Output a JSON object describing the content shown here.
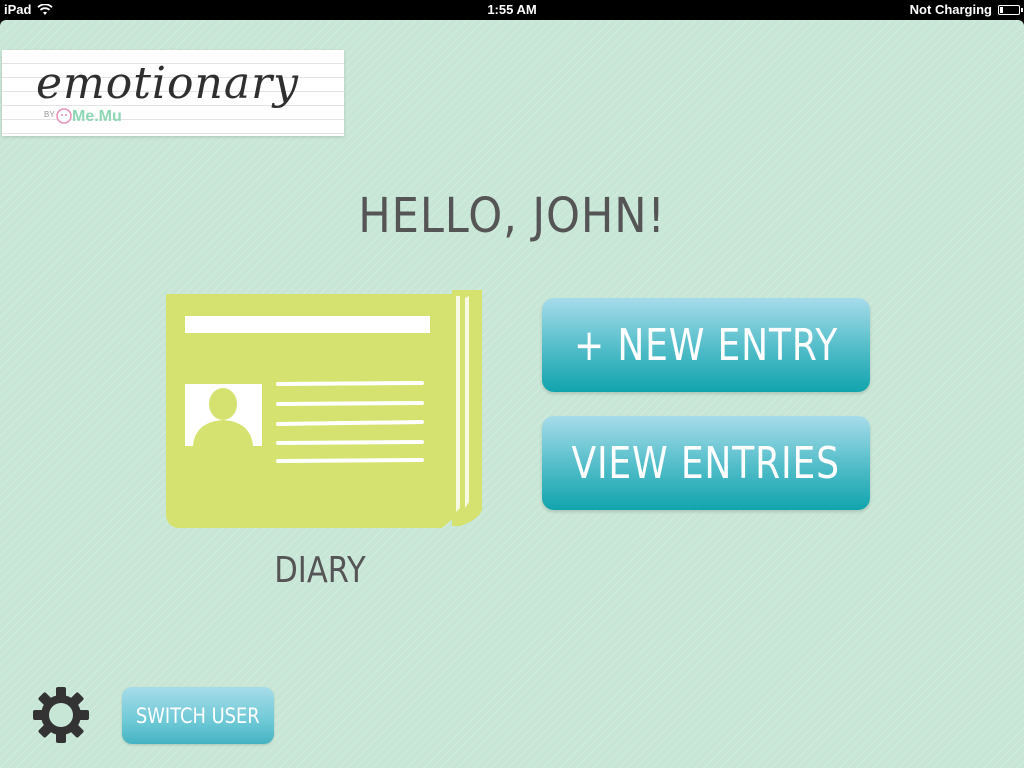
{
  "status_bar": {
    "device": "iPad",
    "time": "1:55 AM",
    "charging_status": "Not Charging",
    "battery_level": 0.15
  },
  "logo": {
    "wordmark": "emotionary",
    "by": "BY",
    "brand": "Me.Mu"
  },
  "greeting": "HELLO, JOHN!",
  "diary": {
    "label": "DIARY",
    "icon": "diary-icon"
  },
  "buttons": {
    "new_entry": "+ NEW ENTRY",
    "view_entries": "VIEW ENTRIES",
    "switch_user": "SWITCH USER"
  },
  "icons": {
    "settings": "gear-icon",
    "wifi": "wifi-icon",
    "battery": "battery-icon"
  },
  "colors": {
    "background": "#c8e6d6",
    "diary_green": "#d5e26f",
    "button_teal": "#11a4ad",
    "button_light": "#a7dcea",
    "text_gray": "#555555"
  }
}
